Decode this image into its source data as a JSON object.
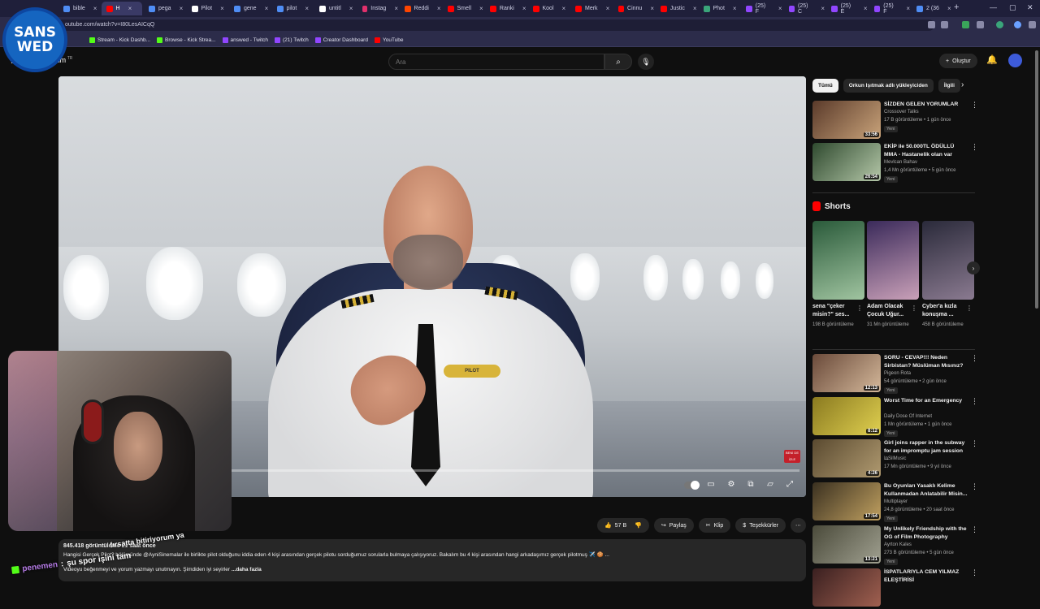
{
  "browser": {
    "tabs": [
      {
        "label": "bible",
        "color": "#4f8df5",
        "active": false
      },
      {
        "label": "H",
        "color": "#ff0000",
        "active": true
      },
      {
        "label": "pega",
        "color": "#4f8df5",
        "active": false
      },
      {
        "label": "Pilot",
        "color": "#ffffff",
        "active": false
      },
      {
        "label": "gene",
        "color": "#4f8df5",
        "active": false
      },
      {
        "label": "pilot",
        "color": "#4f8df5",
        "active": false
      },
      {
        "label": "untitl",
        "color": "#ffffff",
        "active": false
      },
      {
        "label": "Instag",
        "color": "#e1306c",
        "active": false
      },
      {
        "label": "Reddi",
        "color": "#ff4500",
        "active": false
      },
      {
        "label": "Smell",
        "color": "#ff0000",
        "active": false
      },
      {
        "label": "Ranki",
        "color": "#ff0000",
        "active": false
      },
      {
        "label": "Kool",
        "color": "#ff0000",
        "active": false
      },
      {
        "label": "Merk",
        "color": "#ff0000",
        "active": false
      },
      {
        "label": "Cinnu",
        "color": "#ff0000",
        "active": false
      },
      {
        "label": "Justic",
        "color": "#ff0000",
        "active": false
      },
      {
        "label": "Phot",
        "color": "#3aa57a",
        "active": false
      },
      {
        "label": "(25) F",
        "color": "#9146ff",
        "active": false
      },
      {
        "label": "(25) C",
        "color": "#9146ff",
        "active": false
      },
      {
        "label": "(25) E",
        "color": "#9146ff",
        "active": false
      },
      {
        "label": "(25) F",
        "color": "#9146ff",
        "active": false
      },
      {
        "label": "2 (36",
        "color": "#4f8df5",
        "active": false
      }
    ],
    "url": "outube.com/watch?v=I80LesAICqQ",
    "bookmarks": [
      {
        "label": "Stream - Kick Dashb...",
        "color": "#53fc18"
      },
      {
        "label": "Browse - Kick Strea...",
        "color": "#53fc18"
      },
      {
        "label": "answed - Twitch",
        "color": "#9146ff"
      },
      {
        "label": "(21) Twitch",
        "color": "#9146ff"
      },
      {
        "label": "Creator Dashboard",
        "color": "#9146ff"
      },
      {
        "label": "YouTube",
        "color": "#ff0000"
      }
    ]
  },
  "overlay": {
    "logo_line1": "SANS",
    "logo_line2": "WED",
    "chat_line1": "fırsatta bitiriyorum ya",
    "chat_user": "penemen",
    "chat_msg": "şu spor işini tam"
  },
  "youtube": {
    "logo_suffix": "mium",
    "logo_tr": "TR",
    "search_placeholder": "Ara",
    "create_label": "Oluştur",
    "actions": {
      "like_count": "57 B",
      "share": "Paylaş",
      "clip": "Klip",
      "thanks": "Teşekkürler"
    },
    "description": {
      "stats": "845.418 görüntüleme  21 saat önce",
      "line1": "Hangisi Gerçek Pilot? bölümünde @AyniSinemalar ile birlikte pilot olduğunu iddia eden 4 kişi arasından gerçek pilotu sorduğumuz sorularla bulmaya çalışıyoruz. Bakalım bu 4 kişi arasından hangi arkadaşımız gerçek pilotmuş ✈️ 🍪 ...",
      "line2": "Videoyu beğenmeyi ve yorum yazmayı unutmayın. Şimdiden iyi seyirler",
      "more": "...daha fazla"
    },
    "video_overlay_text": "BENİ DE İZLE",
    "chips": [
      "Tümü",
      "Orkun Işıtmak adlı yükleyiciden",
      "İlgili"
    ],
    "recs_top": [
      {
        "title": "SİZDEN GELEN YORUMLAR",
        "channel": "Crossover Talks",
        "meta": "17 B görüntüleme • 1 gün önce",
        "badge": "Yeni",
        "duration": "33:56",
        "c1": "#5a3a2a",
        "c2": "#c9a37a"
      },
      {
        "title": "EKİP ile 50.000TL ÖDÜLLÜ MMA - Hastanelik olan var",
        "channel": "Mevlcan Bahav",
        "meta": "1,4 Mn görüntüleme • 5 gün önce",
        "badge": "Yeni",
        "duration": "26:54",
        "c1": "#2f4a2f",
        "c2": "#b4c7a8"
      }
    ],
    "shorts_title": "Shorts",
    "shorts": [
      {
        "title": "sena \"çeker misin?\" ses...",
        "views": "198 B görüntüleme",
        "c1": "#2a5a3a",
        "c2": "#a0c4a0"
      },
      {
        "title": "Adam Olacak Çocuk Uğur...",
        "views": "31 Mn görüntüleme",
        "c1": "#3a2a5a",
        "c2": "#c9a0b8"
      },
      {
        "title": "Cyber'a kızla konuşma ...",
        "views": "458 B görüntüleme",
        "c1": "#2a2a3a",
        "c2": "#8a7a90"
      }
    ],
    "recs": [
      {
        "title": "SORU - CEVAP!!! Neden Sirbistan? Müslüman Mısınız?",
        "channel": "Pigeon Rota",
        "meta": "54 görüntüleme • 2 gün önce",
        "badge": "Yeni",
        "duration": "12:13",
        "c1": "#6a4a3a",
        "c2": "#d4b89a"
      },
      {
        "title": "Worst Time for an Emergency",
        "channel": "Daily Dose Of Internet",
        "meta": "1 Mn görüntüleme • 1 gün önce",
        "badge": "Yeni",
        "duration": "8:12",
        "c1": "#8a7a20",
        "c2": "#e0d050"
      },
      {
        "title": "Girl joins rapper in the subway for an impromptu jam session ...",
        "channel": "InSilMusic",
        "meta": "17 Mn görüntüleme • 9 yıl önce",
        "badge": "",
        "duration": "4:26",
        "c1": "#5a4a30",
        "c2": "#b09a70"
      },
      {
        "title": "Bu Oyunları Yasaklı Kelime Kullanmadan Anlatabilir Misin...",
        "channel": "Multiplayer",
        "meta": "24,8 görüntüleme • 20 saat önce",
        "badge": "Yeni",
        "duration": "17:54",
        "c1": "#3a3020",
        "c2": "#c0a060"
      },
      {
        "title": "My Unlikely Friendship with the OG of Film Photography",
        "channel": "Ayrton Kales",
        "meta": "273 B görüntüleme • 5 gün önce",
        "badge": "Yeni",
        "duration": "13:21",
        "c1": "#4a4a3a",
        "c2": "#a0a090"
      },
      {
        "title": "İSPATLARIYLA CEM YILMAZ ELEŞTİRİSİ",
        "channel": "",
        "meta": "",
        "badge": "",
        "duration": "",
        "c1": "#3a2020",
        "c2": "#a06050"
      }
    ]
  }
}
